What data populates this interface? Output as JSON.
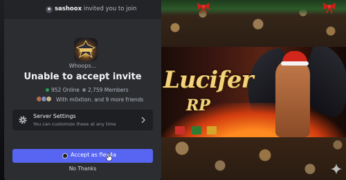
{
  "invite": {
    "inviter_name": "sashoox",
    "invite_text": " invited you to join"
  },
  "server": {
    "whoops": "Whoops...",
    "title": "Unable to accept invite",
    "online_count": "952 Online",
    "member_count": "2,759 Members",
    "friends_text": "With m0xtion. and 9 more friends"
  },
  "settings": {
    "title": "Server Settings",
    "subtitle": "You can customize these at any time"
  },
  "actions": {
    "accept_label": "Accept as flex4a",
    "decline_label": "No Thanks"
  },
  "banner": {
    "title": "Lucifer",
    "subtitle": "RP"
  },
  "colors": {
    "accent": "#5865f2",
    "online": "#23a55a",
    "modal_bg": "#2b2d31"
  }
}
